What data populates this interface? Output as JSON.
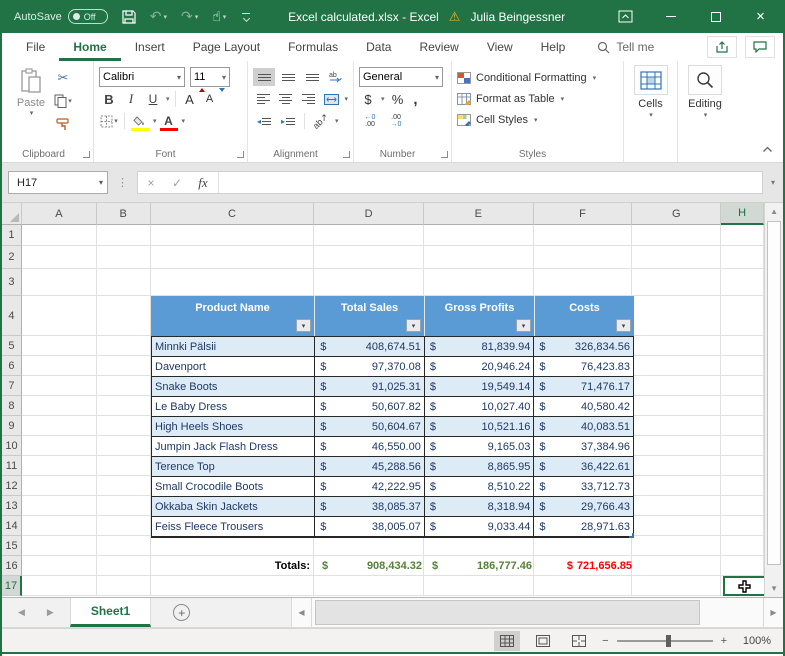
{
  "titlebar": {
    "autosave_label": "AutoSave",
    "autosave_state": "Off",
    "title": "Excel calculated.xlsx - Excel",
    "user": "Julia Beingessner"
  },
  "icons": {
    "undo": "↶",
    "redo": "↷",
    "touch": "☝",
    "dropdown": "▾",
    "warning": "⚠",
    "close": "×",
    "cancel": "×",
    "check": "✓",
    "fx": "fx",
    "ellipsis": "⋮",
    "scissors": "✂",
    "left": "◀",
    "right": "▶",
    "up": "▲",
    "down": "▼",
    "plus": "+",
    "minus": "−",
    "zoom_plus": "+"
  },
  "ribbon_tabs": {
    "items": [
      "File",
      "Home",
      "Insert",
      "Page Layout",
      "Formulas",
      "Data",
      "Review",
      "View",
      "Help"
    ],
    "active": "Home",
    "tellme": "Tell me"
  },
  "ribbon": {
    "paste_label": "Paste",
    "font_name": "Calibri",
    "font_size": "11",
    "bold": "B",
    "italic": "I",
    "underline": "U",
    "grow_font": "A",
    "shrink_font": "A",
    "number_format": "General",
    "accounting": "$",
    "percent": "%",
    "comma": ",",
    "inc_top": "←0",
    "inc_bot": ".00",
    "dec_top": ".00",
    "dec_bot": "→0",
    "styles": [
      "Conditional Formatting",
      "Format as Table",
      "Cell Styles"
    ],
    "cells_label": "Cells",
    "editing_label": "Editing",
    "group_labels": {
      "clipboard": "Clipboard",
      "font": "Font",
      "alignment": "Alignment",
      "number": "Number",
      "styles": "Styles"
    }
  },
  "formula_bar": {
    "name_box": "H17",
    "formula": ""
  },
  "spreadsheet": {
    "col_headers": [
      "A",
      "B",
      "C",
      "D",
      "E",
      "F",
      "G",
      "H"
    ],
    "row_count": 17,
    "selected_col": "H",
    "selected_row": 17,
    "selected_cell": "H17"
  },
  "table": {
    "currency": "$",
    "headers": [
      "Product Name",
      "Total Sales",
      "Gross Profits",
      "Costs"
    ],
    "rows": [
      {
        "name": "Minnki Pälsii",
        "sales": "408,674.51",
        "profit": "81,839.94",
        "cost": "326,834.56"
      },
      {
        "name": "Davenport",
        "sales": "97,370.08",
        "profit": "20,946.24",
        "cost": "76,423.83"
      },
      {
        "name": "Snake Boots",
        "sales": "91,025.31",
        "profit": "19,549.14",
        "cost": "71,476.17"
      },
      {
        "name": "Le Baby Dress",
        "sales": "50,607.82",
        "profit": "10,027.40",
        "cost": "40,580.42"
      },
      {
        "name": "High Heels Shoes",
        "sales": "50,604.67",
        "profit": "10,521.16",
        "cost": "40,083.51"
      },
      {
        "name": "Jumpin Jack Flash Dress",
        "sales": "46,550.00",
        "profit": "9,165.03",
        "cost": "37,384.96"
      },
      {
        "name": "Terence Top",
        "sales": "45,288.56",
        "profit": "8,865.95",
        "cost": "36,422.61"
      },
      {
        "name": "Small Crocodile Boots",
        "sales": "42,222.95",
        "profit": "8,510.22",
        "cost": "33,712.73"
      },
      {
        "name": "Okkaba Skin Jackets",
        "sales": "38,085.37",
        "profit": "8,318.94",
        "cost": "29,766.43"
      },
      {
        "name": "Feiss Fleece Trousers",
        "sales": "38,005.07",
        "profit": "9,033.44",
        "cost": "28,971.63"
      }
    ],
    "totals": {
      "label": "Totals:",
      "sales": "908,434.32",
      "profit": "186,777.46",
      "cost": "721,656.85"
    }
  },
  "sheet_bar": {
    "tabs": [
      "Sheet1"
    ],
    "active": "Sheet1"
  },
  "status_bar": {
    "zoom": "100%"
  },
  "colors": {
    "excel_green": "#217346",
    "table_header_blue": "#5b9bd5",
    "band_blue": "#ddebf7",
    "totals_green": "#548235",
    "totals_red": "#ff0000"
  }
}
